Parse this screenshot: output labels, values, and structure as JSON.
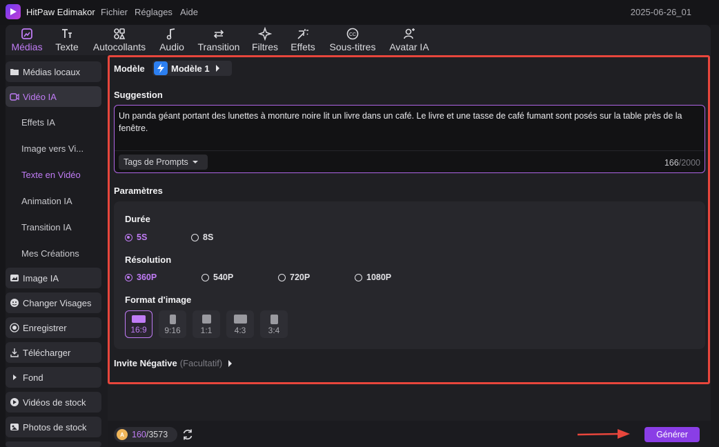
{
  "app": {
    "title": "HitPaw Edimakor",
    "project_name": "2025-06-26_01"
  },
  "menu": [
    "Fichier",
    "Réglages",
    "Aide"
  ],
  "toolbar": {
    "tools": [
      {
        "label": "Médias",
        "icon": "media-icon",
        "active": true
      },
      {
        "label": "Texte",
        "icon": "text-icon"
      },
      {
        "label": "Autocollants",
        "icon": "sticker-icon"
      },
      {
        "label": "Audio",
        "icon": "music-note-icon"
      },
      {
        "label": "Transition",
        "icon": "transition-icon"
      },
      {
        "label": "Filtres",
        "icon": "sparkle-icon"
      },
      {
        "label": "Effets",
        "icon": "magic-wand-icon"
      },
      {
        "label": "Sous-titres",
        "icon": "subtitles-icon"
      },
      {
        "label": "Avatar IA",
        "icon": "avatar-icon"
      }
    ]
  },
  "sidebar": {
    "items": [
      {
        "label": "Médias locaux",
        "icon": "folder-icon"
      },
      {
        "label": "Vidéo IA",
        "icon": "ai-video-icon",
        "active": true
      },
      {
        "label": "Image IA",
        "icon": "image-icon"
      },
      {
        "label": "Changer Visages",
        "icon": "face-swap-icon"
      },
      {
        "label": "Enregistrer",
        "icon": "record-icon"
      },
      {
        "label": "Télécharger",
        "icon": "download-icon"
      },
      {
        "label": "Fond",
        "icon": "chevron-right-icon"
      },
      {
        "label": "Vidéos de stock",
        "icon": "stock-video-icon"
      },
      {
        "label": "Photos de stock",
        "icon": "stock-photo-icon"
      }
    ],
    "sub_items": [
      "Effets IA",
      "Image vers Vi...",
      "Texte en Vidéo",
      "Animation IA",
      "Transition IA",
      "Mes Créations"
    ],
    "active_sub": "Texte en Vidéo"
  },
  "form": {
    "model_label": "Modèle",
    "model_value": "Modèle 1",
    "suggestion_label": "Suggestion",
    "prompt": "Un panda géant portant des lunettes à monture noire lit un livre dans un café. Le livre et une tasse de café fumant sont posés sur la table près de la fenêtre.",
    "tags_button": "Tags de Prompts",
    "char_count": "166",
    "char_max": "/2000",
    "params_label": "Paramètres",
    "duration": {
      "label": "Durée",
      "options": [
        "5S",
        "8S"
      ],
      "selected": "5S"
    },
    "resolution": {
      "label": "Résolution",
      "options": [
        "360P",
        "540P",
        "720P",
        "1080P"
      ],
      "selected": "360P"
    },
    "format": {
      "label": "Format d'image",
      "options": [
        "16:9",
        "9:16",
        "1:1",
        "4:3",
        "3:4"
      ],
      "selected": "16:9"
    },
    "negative_label": "Invite Négative",
    "negative_optional": "(Facultatif)"
  },
  "footer": {
    "credits_used": "160",
    "credits_total": "/3573",
    "generate_label": "Générer"
  },
  "colors": {
    "accent": "#c07cf5",
    "button": "#8a3ee6",
    "highlight_border": "#e8463c"
  }
}
